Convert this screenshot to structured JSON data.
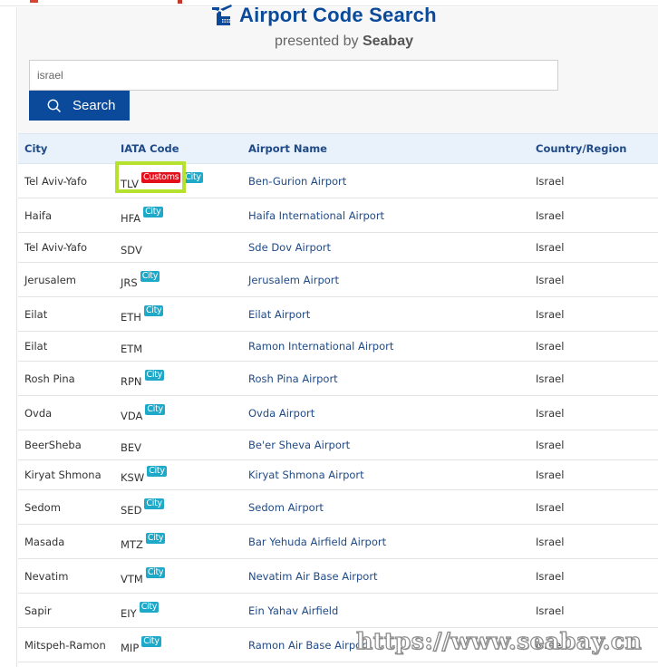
{
  "header": {
    "title": "Airport Code Search",
    "subtitle_prefix": "presented by ",
    "subtitle_brand": "Seabay",
    "logo_icon": "airport-tower-icon"
  },
  "search": {
    "value": "israel",
    "placeholder": "",
    "button_label": "Search",
    "button_icon": "search-icon"
  },
  "colors": {
    "primary": "#0b4a9a",
    "header_bg": "#e9f2fb",
    "header_text": "#1f4a87",
    "badge_customs": "#e3101b",
    "badge_city": "#1fa9c9",
    "highlight": "#b6e12e"
  },
  "table": {
    "columns": [
      "City",
      "IATA Code",
      "Airport Name",
      "Country/Region"
    ],
    "rows": [
      {
        "city": "Tel Aviv-Yafo",
        "iata": "TLV",
        "customs": "Customs",
        "city_badge": "City",
        "name": "Ben-Gurion Airport",
        "country": "Israel",
        "highlighted": true
      },
      {
        "city": "Haifa",
        "iata": "HFA",
        "customs": null,
        "city_badge": "City",
        "name": "Haifa International Airport",
        "country": "Israel"
      },
      {
        "city": "Tel Aviv-Yafo",
        "iata": "SDV",
        "customs": null,
        "city_badge": null,
        "name": "Sde Dov Airport",
        "country": "Israel"
      },
      {
        "city": "Jerusalem",
        "iata": "JRS",
        "customs": null,
        "city_badge": "City",
        "name": "Jerusalem Airport",
        "country": "Israel"
      },
      {
        "city": "Eilat",
        "iata": "ETH",
        "customs": null,
        "city_badge": "City",
        "name": "Eilat Airport",
        "country": "Israel"
      },
      {
        "city": "Eilat",
        "iata": "ETM",
        "customs": null,
        "city_badge": null,
        "name": "Ramon International Airport",
        "country": "Israel"
      },
      {
        "city": "Rosh Pina",
        "iata": "RPN",
        "customs": null,
        "city_badge": "City",
        "name": "Rosh Pina Airport",
        "country": "Israel"
      },
      {
        "city": "Ovda",
        "iata": "VDA",
        "customs": null,
        "city_badge": "City",
        "name": "Ovda Airport",
        "country": "Israel"
      },
      {
        "city": "BeerSheba",
        "iata": "BEV",
        "customs": null,
        "city_badge": null,
        "name": "Be'er Sheva Airport",
        "country": "Israel"
      },
      {
        "city": "Kiryat Shmona",
        "iata": "KSW",
        "customs": null,
        "city_badge": "City",
        "name": "Kiryat Shmona Airport",
        "country": "Israel"
      },
      {
        "city": "Sedom",
        "iata": "SED",
        "customs": null,
        "city_badge": "City",
        "name": "Sedom Airport",
        "country": "Israel"
      },
      {
        "city": "Masada",
        "iata": "MTZ",
        "customs": null,
        "city_badge": "City",
        "name": "Bar Yehuda Airfield Airport",
        "country": "Israel"
      },
      {
        "city": "Nevatim",
        "iata": "VTM",
        "customs": null,
        "city_badge": "City",
        "name": "Nevatim Air Base Airport",
        "country": "Israel"
      },
      {
        "city": "Sapir",
        "iata": "EIY",
        "customs": null,
        "city_badge": "City",
        "name": "Ein Yahav Airfield",
        "country": "Israel"
      },
      {
        "city": "Mitspeh-Ramon",
        "iata": "MIP",
        "customs": null,
        "city_badge": "City",
        "name": "Ramon Air Base Airport",
        "country": "Israel"
      }
    ]
  },
  "watermark": "https://www.seabay.cn"
}
